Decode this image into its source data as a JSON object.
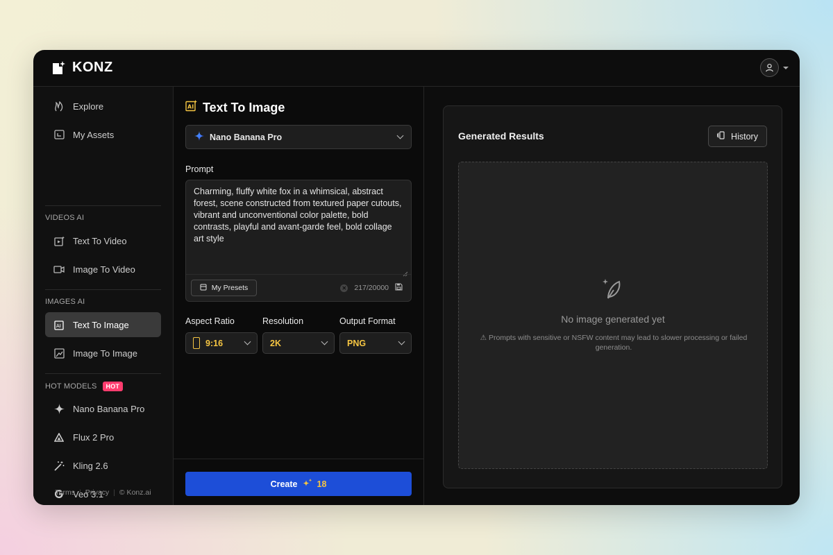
{
  "brand": {
    "name": "KONZ"
  },
  "sidebar": {
    "top_items": [
      {
        "label": "Explore",
        "icon": "flame-icon"
      },
      {
        "label": "My Assets",
        "icon": "assets-icon"
      }
    ],
    "videos_section": {
      "title": "VIDEOS AI",
      "items": [
        {
          "label": "Text To Video",
          "icon": "text-video-icon"
        },
        {
          "label": "Image To Video",
          "icon": "image-video-icon"
        }
      ]
    },
    "images_section": {
      "title": "IMAGES AI",
      "items": [
        {
          "label": "Text To Image",
          "icon": "text-image-icon",
          "active": true
        },
        {
          "label": "Image To Image",
          "icon": "image-image-icon"
        }
      ]
    },
    "models_section": {
      "title": "HOT MODELS",
      "badge": "HOT",
      "items": [
        {
          "label": "Nano Banana Pro",
          "icon": "sparkle-icon"
        },
        {
          "label": "Flux 2 Pro",
          "icon": "triangle-icon"
        },
        {
          "label": "Kling 2.6",
          "icon": "magic-wand-icon"
        },
        {
          "label": "Veo 3.1",
          "icon": "google-icon"
        }
      ]
    },
    "footer": {
      "terms": "Terms",
      "separator": "|",
      "privacy": "Privacy",
      "copyright": "© Konz.ai"
    }
  },
  "editor": {
    "title": "Text To Image",
    "model": "Nano Banana Pro",
    "prompt_label": "Prompt",
    "prompt_value": "Charming, fluffy white fox in a whimsical, abstract forest, scene constructed from textured paper cutouts, vibrant and unconventional color palette, bold contrasts, playful and avant-garde feel, bold collage art style",
    "presets_label": "My Presets",
    "char_count": "217/20000",
    "aspect_label": "Aspect Ratio",
    "aspect_value": "9:16",
    "resolution_label": "Resolution",
    "resolution_value": "2K",
    "format_label": "Output Format",
    "format_value": "PNG",
    "create_label": "Create",
    "create_cost": "18"
  },
  "results": {
    "title": "Generated Results",
    "history_label": "History",
    "empty_title": "No image generated yet",
    "empty_note": "⚠ Prompts with sensitive or NSFW content may lead to slower processing or failed generation."
  },
  "colors": {
    "accent_blue": "#1d4ed8",
    "accent_yellow": "#f5c542",
    "hot_badge": "#ff3c6e"
  }
}
